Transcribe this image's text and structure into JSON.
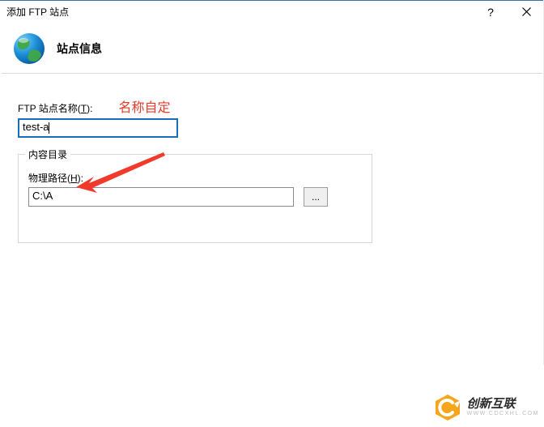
{
  "titlebar": {
    "title": "添加 FTP 站点"
  },
  "header": {
    "title": "站点信息"
  },
  "site_name": {
    "label_pre": "FTP 站点名称(",
    "label_hot": "T",
    "label_post": "):",
    "value": "test-a",
    "annotation": "名称自定"
  },
  "content_group": {
    "legend": "内容目录",
    "path_label_pre": "物理路径(",
    "path_label_hot": "H",
    "path_label_post": "):",
    "path_value": "C:\\A",
    "browse_label": "..."
  },
  "watermark": {
    "brand_cn": "创新互联",
    "brand_en": "WWW.CDCXHL.COM"
  }
}
